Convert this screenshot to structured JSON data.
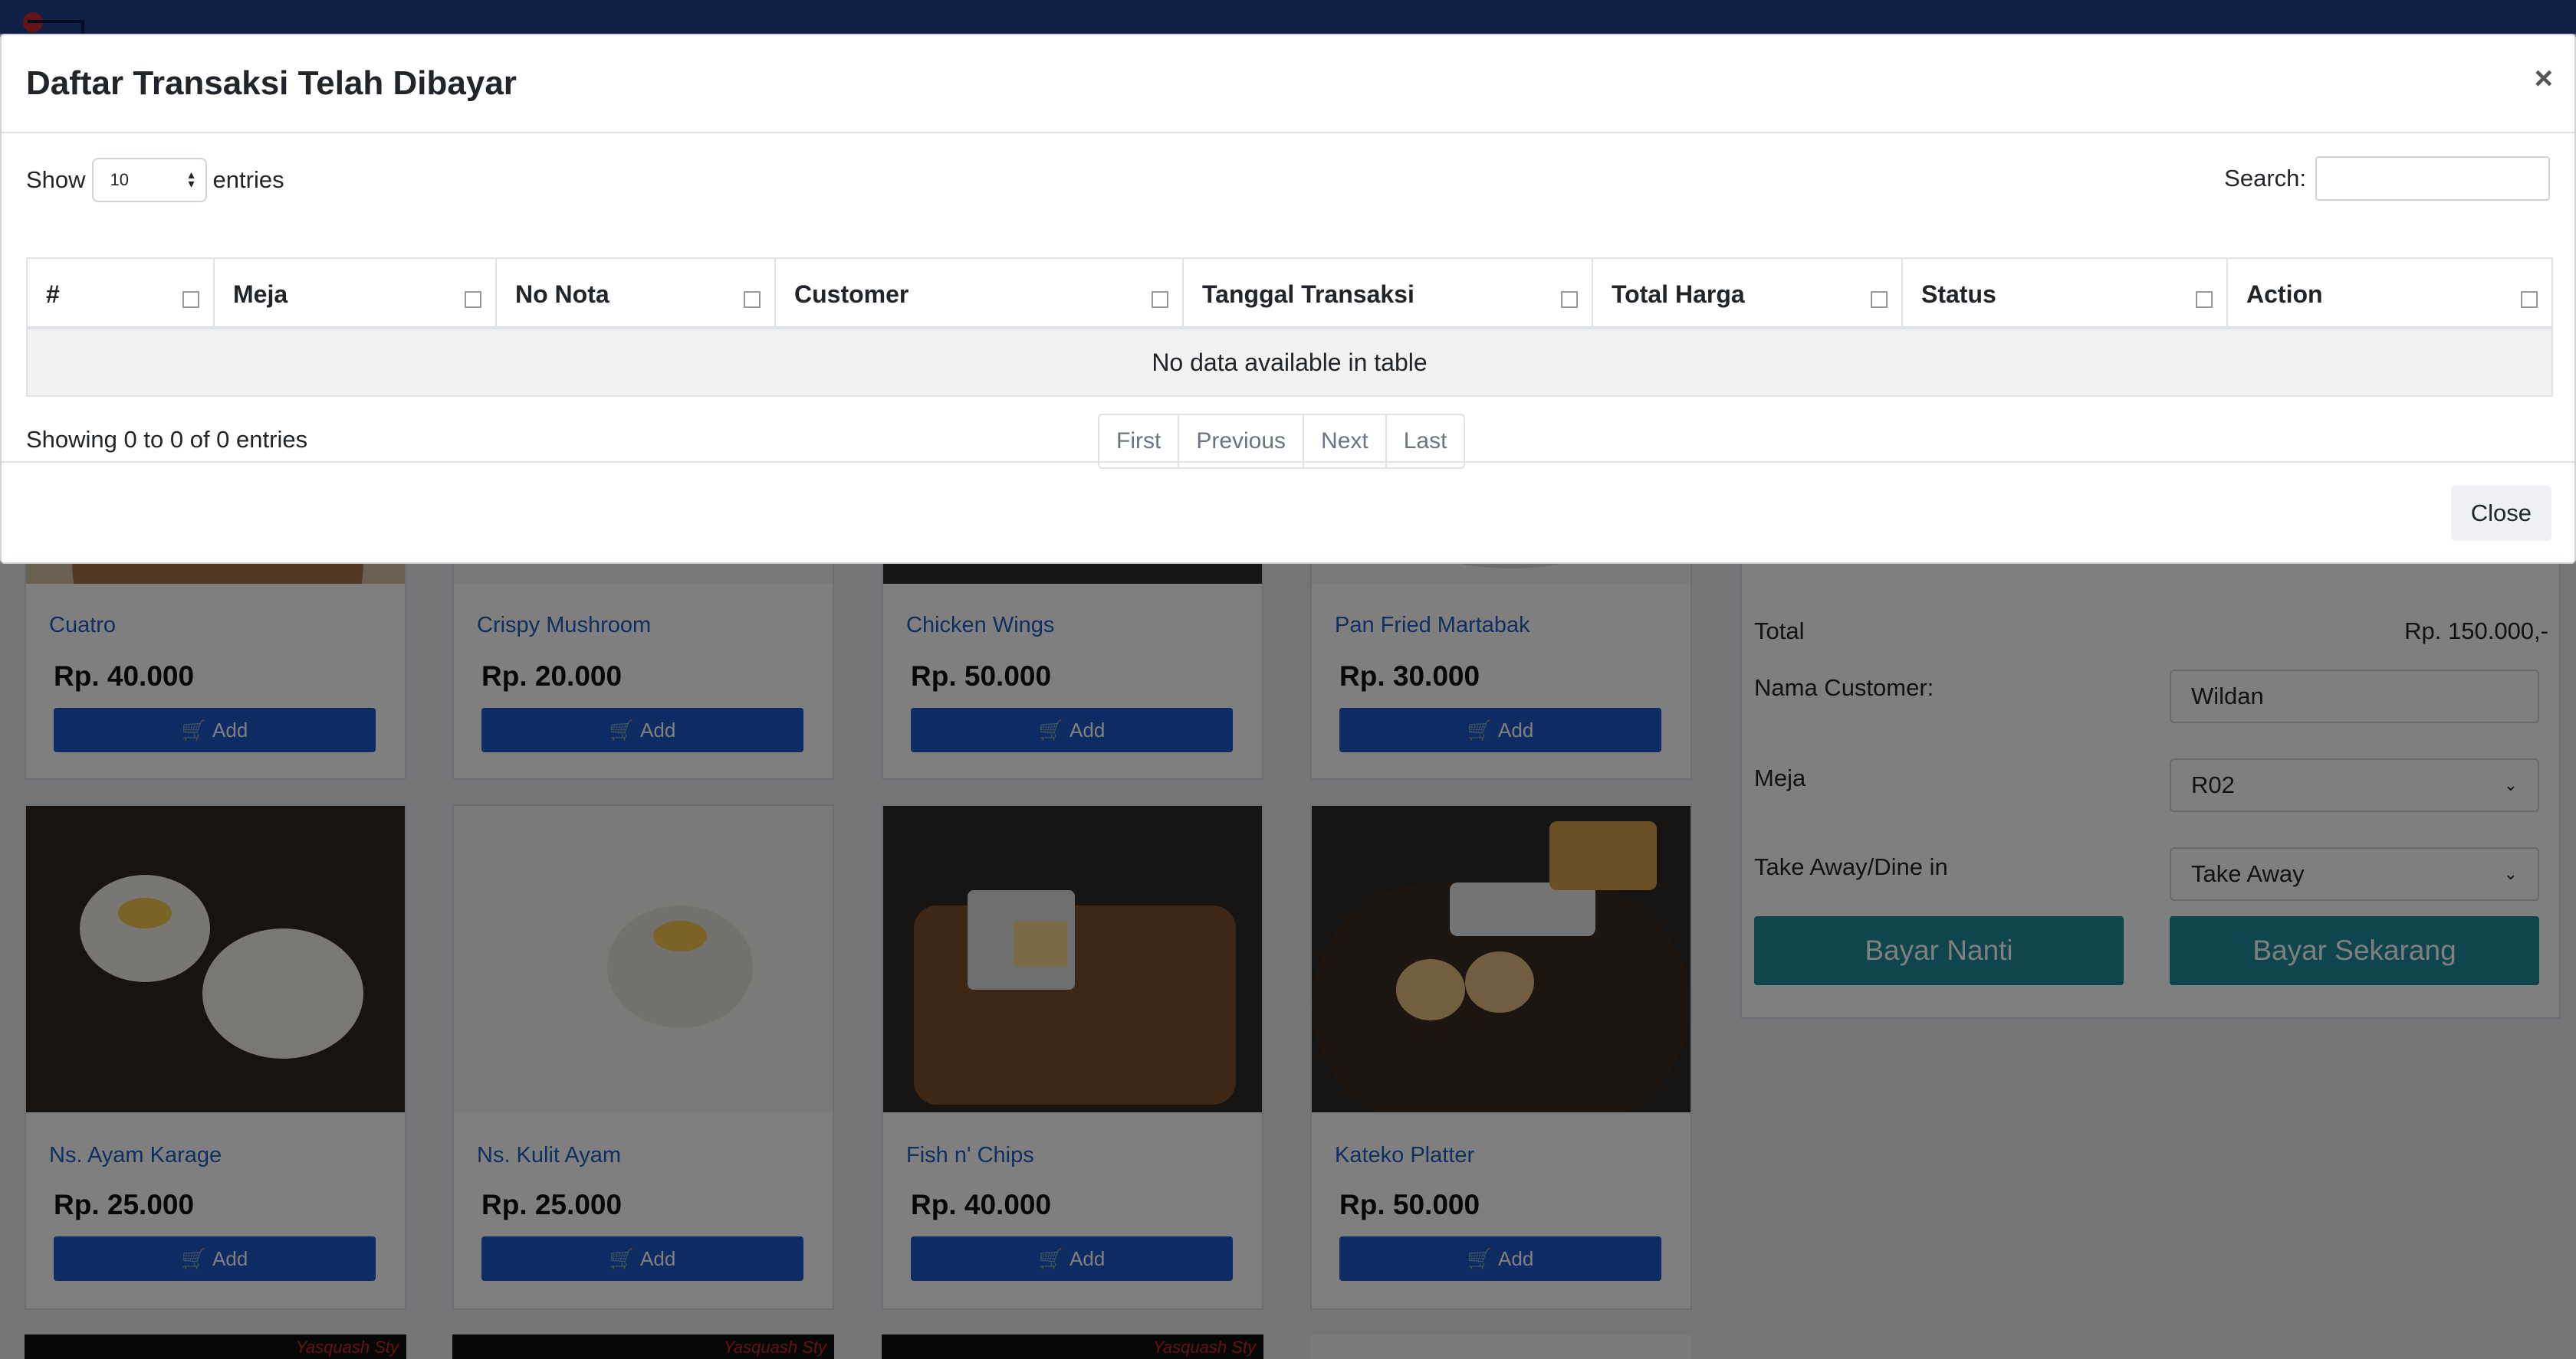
{
  "modal": {
    "title": "Daftar Transaksi Telah Dibayar",
    "close_x": "×",
    "length": {
      "show_label": "Show",
      "value": "10",
      "entries_label": "entries"
    },
    "search_label": "Search:",
    "columns": [
      "#",
      "Meja",
      "No Nota",
      "Customer",
      "Tanggal Transaksi",
      "Total Harga",
      "Status",
      "Action"
    ],
    "empty_message": "No data available in table",
    "info": "Showing 0 to 0 of 0 entries",
    "pagination": [
      "First",
      "Previous",
      "Next",
      "Last"
    ],
    "close_label": "Close"
  },
  "menu": {
    "add_label": "Add",
    "row1": [
      {
        "name": "Cuatro",
        "price": "Rp. 40.000"
      },
      {
        "name": "Crispy Mushroom",
        "price": "Rp. 20.000"
      },
      {
        "name": "Chicken Wings",
        "price": "Rp. 50.000"
      },
      {
        "name": "Pan Fried Martabak",
        "price": "Rp. 30.000"
      }
    ],
    "row2": [
      {
        "name": "Ns. Ayam Karage",
        "price": "Rp. 25.000"
      },
      {
        "name": "Ns. Kulit Ayam",
        "price": "Rp. 25.000"
      },
      {
        "name": "Fish n' Chips",
        "price": "Rp. 40.000"
      },
      {
        "name": "Kateko Platter",
        "price": "Rp. 50.000"
      }
    ],
    "row3_watermark": "Yasquash Sty"
  },
  "order": {
    "total_label": "Total",
    "total_value": "Rp. 150.000,-",
    "customer_label": "Nama Customer:",
    "customer_value": "Wildan",
    "table_label": "Meja",
    "table_value": "R02",
    "mode_label": "Take Away/Dine in",
    "mode_value": "Take Away",
    "pay_later": "Bayar Nanti",
    "pay_now": "Bayar Sekarang"
  },
  "colors": {
    "topbar": "#1e3f8a",
    "add_button": "#1f56c8",
    "pay_button": "#1f8a99",
    "product_link": "#1f5fbf"
  }
}
